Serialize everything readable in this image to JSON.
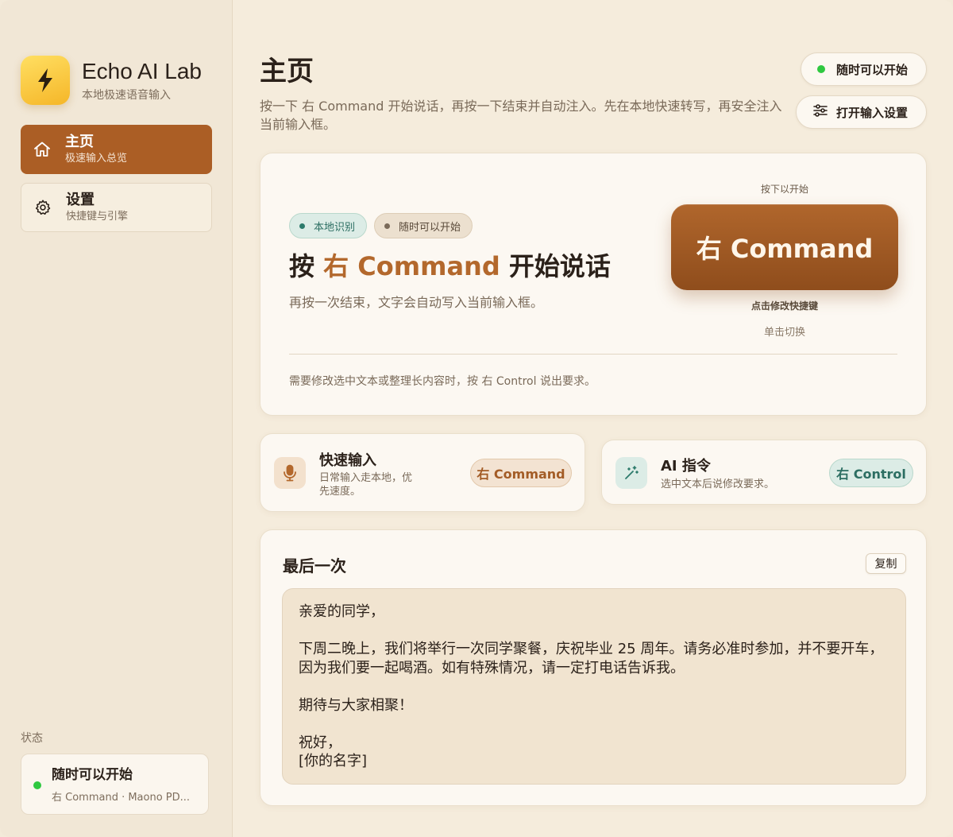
{
  "window": {
    "title": "Echo AI Lab"
  },
  "sidebar": {
    "brand_title": "Echo AI Lab",
    "brand_subtitle": "本地极速语音输入",
    "brand_icon": "lightning-icon",
    "items": [
      {
        "label": "主页",
        "sublabel": "极速输入总览",
        "icon": "home-icon",
        "active": true
      },
      {
        "label": "设置",
        "sublabel": "快捷键与引擎",
        "icon": "gear-icon",
        "active": false
      }
    ],
    "status_label": "状态",
    "status_title": "随时可以开始",
    "status_detail": "右 Command · Maono PD..."
  },
  "header": {
    "title": "主页",
    "description": "按一下 右 Command 开始说话，再按一下结束并自动注入。先在本地快速转写，再安全注入当前输入框。",
    "status_pill": "随时可以开始",
    "settings_button": "打开输入设置"
  },
  "hero": {
    "tags": [
      "本地识别",
      "随时可以开始"
    ],
    "title_prefix": "按 ",
    "title_key": "右 Command",
    "title_suffix": " 开始说话",
    "description": "再按一次结束，文字会自动写入当前输入框。",
    "hint_top": "按下以开始",
    "key_label": "右 Command",
    "hint_edit": "点击修改快捷键",
    "hint_toggle": "单击切换",
    "footer": "需要修改选中文本或整理长内容时，按 右 Control 说出要求。"
  },
  "modes": {
    "fast": {
      "title": "快速输入",
      "subtitle": "日常输入走本地，优先速度。",
      "key": "右 Command",
      "icon": "microphone-icon"
    },
    "ai": {
      "title": "AI 指令",
      "subtitle": "选中文本后说修改要求。",
      "key": "右 Control",
      "icon": "magic-wand-icon"
    }
  },
  "last": {
    "title": "最后一次",
    "copy_button": "复制",
    "lines": [
      "亲爱的同学，",
      "",
      "下周二晚上，我们将举行一次同学聚餐，庆祝毕业 25 周年。请务必准时参加，并不要开车，因为我们要一起喝酒。如有特殊情况，请一定打电话告诉我。",
      "",
      "期待与大家相聚！",
      "",
      "祝好，",
      "[你的名字]"
    ]
  },
  "colors": {
    "accent": "#ab5e25",
    "accent_text": "#b3682c",
    "teal": "#2c6e62",
    "status_green": "#2fc840",
    "background": "#f5ecdc"
  }
}
